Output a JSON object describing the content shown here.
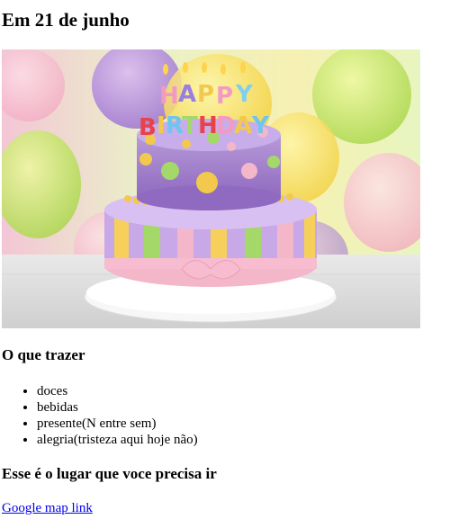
{
  "heading": "Em 21 de junho",
  "hero_image": {
    "subject": "birthday-cake",
    "cake_text": "HAPPY BIRTHDAY"
  },
  "bring_section": {
    "title": "O que trazer",
    "items": [
      "doces",
      "bebidas",
      "presente(N entre sem)",
      "alegria(tristeza aqui hoje não)"
    ]
  },
  "place_section": {
    "title": "Esse é o lugar que voce precisa ir",
    "link_label": "Google map link"
  },
  "colors": {
    "link": "#0000ee",
    "text": "#000000",
    "background": "#ffffff"
  }
}
